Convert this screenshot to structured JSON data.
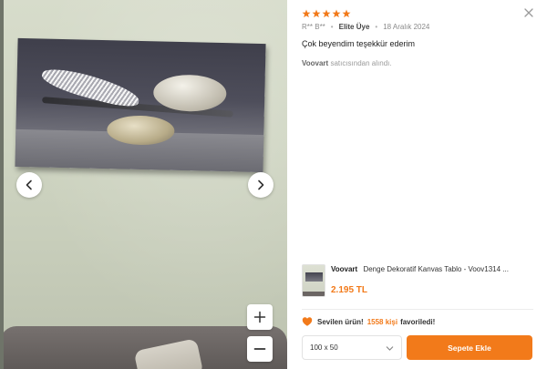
{
  "colors": {
    "accent": "#f27a1a",
    "star": "#f27a1a",
    "text": "#333333",
    "muted": "#8a8a8a"
  },
  "gallery": {
    "prev_icon": "chevron-left-icon",
    "next_icon": "chevron-right-icon",
    "zoom_in_icon": "plus-icon",
    "zoom_out_icon": "minus-icon"
  },
  "review": {
    "rating": 5,
    "rating_max": 5,
    "reviewer": "R** B**",
    "badge": "Elite Üye",
    "date": "18 Aralık 2024",
    "comment": "Çok beyendim teşekkür ederim",
    "seller": "Voovart",
    "seller_suffix": "satıcısından alındı."
  },
  "product": {
    "brand": "Voovart",
    "name": "Denge Dekoratif Kanvas Tablo - Voov1314 ...",
    "price": "2.195 TL"
  },
  "favorite": {
    "icon": "heart-icon",
    "label": "Sevilen ürün!",
    "count": "1558 kişi",
    "suffix": "favoriledi!"
  },
  "actions": {
    "size_selected": "100 x 50",
    "add_to_cart": "Sepete Ekle"
  }
}
